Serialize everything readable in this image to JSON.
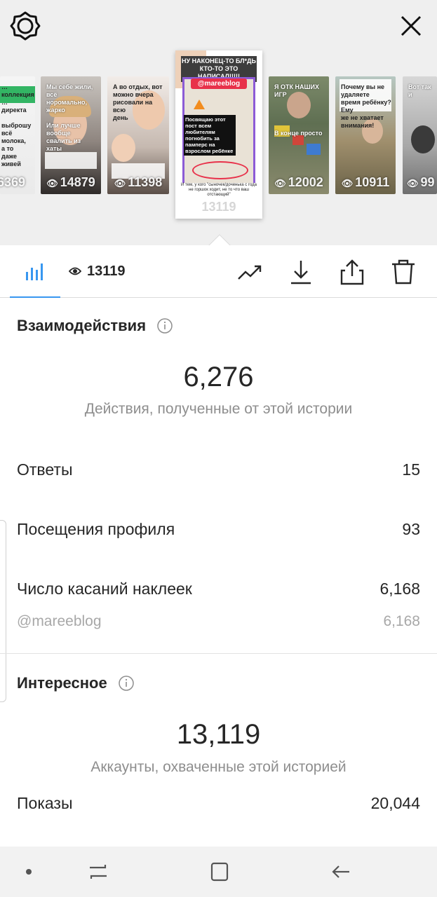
{
  "header": {
    "gear_icon": "settings-gear-icon",
    "close_icon": "close-x-icon"
  },
  "stories": [
    {
      "views": "6369",
      "caption": "… коллекция\n… директа\n\nвыброшу всё\nмолока, а то\nдаже живей"
    },
    {
      "views": "14879",
      "caption": "Мы себе жили, всё\nноромально, жарко\n\nИли лучше вообще\nсвалить из хаты"
    },
    {
      "views": "11398",
      "caption": "А во отдых, вот\nможно вчера\nрисовали на всю\nдень"
    },
    {
      "views": "12002",
      "caption": "Я ОТК НАШИХ ИГР\n\n\n\n\nВ конце просто"
    },
    {
      "views": "10911",
      "caption": "Почему вы не удаляете\nвремя ребёнку? Ему\nже не хватает внимания!"
    },
    {
      "views": "99",
      "caption": "Вот так и"
    }
  ],
  "selected_story": {
    "headline": "НУ НАКОНЕЦ-ТО БЛ*ДЬ КТО-ТО ЭТО НАПИСАЛ!!!!!",
    "handle": "@mareeblog",
    "text": "Посвящаю этот пост всем любителям погнобить за памперс на взрослом ребёнке",
    "footer": "И тем, у кого \"сыночек/доченька с года не горшок ходит, не то что ваш отстающий\"",
    "views": "13119"
  },
  "tabs": {
    "views_count": "13119",
    "icons": [
      "bar-chart-icon",
      "eye-icon",
      "trend-up-icon",
      "download-icon",
      "share-icon",
      "trash-icon"
    ]
  },
  "interactions": {
    "title": "Взаимодействия",
    "total": "6,276",
    "caption": "Действия, полученные от этой истории",
    "rows": [
      {
        "label": "Ответы",
        "value": "15"
      },
      {
        "label": "Посещения профиля",
        "value": "93"
      },
      {
        "label": "Число касаний наклеек",
        "value": "6,168"
      },
      {
        "label": "@mareeblog",
        "value": "6,168"
      }
    ]
  },
  "discovery": {
    "title": "Интересное",
    "total": "13,119",
    "caption": "Аккаунты, охваченные этой историей",
    "rows": [
      {
        "label": "Показы",
        "value": "20,044"
      }
    ]
  },
  "navbar": {
    "icons": [
      "dot-icon",
      "recent-apps-icon",
      "home-icon",
      "back-icon"
    ]
  },
  "colors": {
    "accent": "#3897f0",
    "text": "#262626",
    "muted": "#8e8e8e",
    "top_bg": "#efefef"
  }
}
